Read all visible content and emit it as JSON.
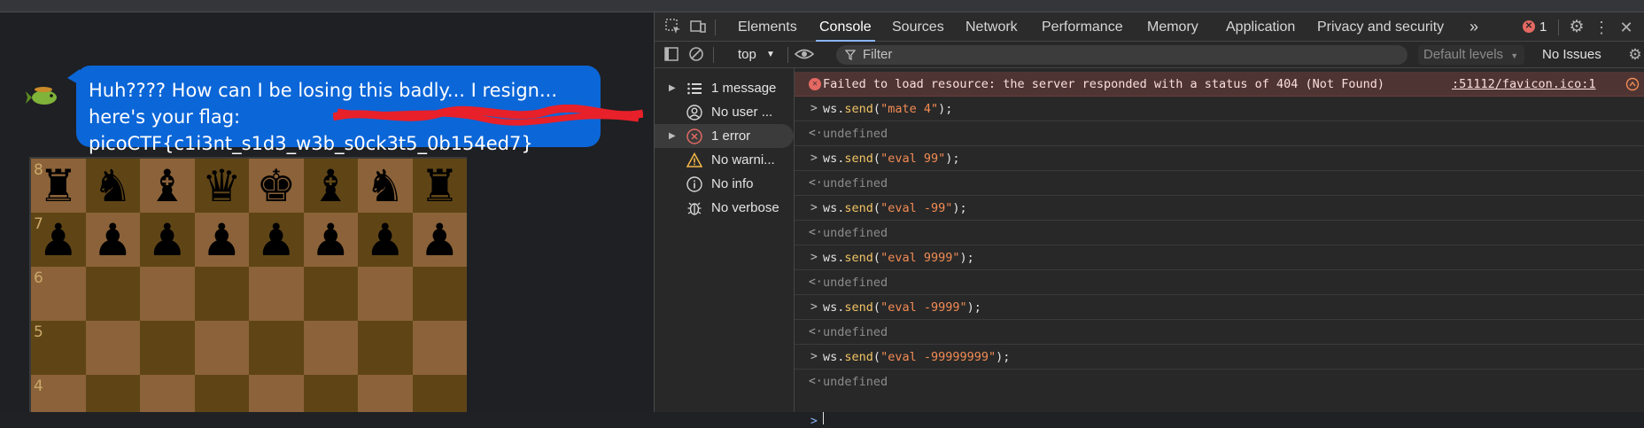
{
  "chat": {
    "message": "Huh???? How can I be losing this badly... I resign... here's your flag: picoCTF{c1i3nt_s1d3_w3b_s0ck3t5_0b154ed7}"
  },
  "board": {
    "ranks": [
      "8",
      "7",
      "6",
      "5",
      "4"
    ],
    "rank8": [
      "♜",
      "♞",
      "♝",
      "♛",
      "♚",
      "♝",
      "♞",
      "♜"
    ],
    "rank7": [
      "♟",
      "♟",
      "♟",
      "♟",
      "♟",
      "♟",
      "♟",
      "♟"
    ]
  },
  "devtools": {
    "tabs": [
      "Elements",
      "Console",
      "Sources",
      "Network",
      "Performance",
      "Memory",
      "Application",
      "Privacy and security"
    ],
    "active_tab": "Console",
    "error_count": "1",
    "toolbar": {
      "context": "top",
      "filter_placeholder": "Filter",
      "levels": "Default levels",
      "issues": "No Issues"
    },
    "sidebar": [
      {
        "label": "1 message",
        "icon": "list-icon"
      },
      {
        "label": "No user ...",
        "icon": "user-icon"
      },
      {
        "label": "1 error",
        "icon": "error-icon"
      },
      {
        "label": "No warni...",
        "icon": "warning-icon"
      },
      {
        "label": "No info",
        "icon": "info-icon"
      },
      {
        "label": "No verbose",
        "icon": "bug-icon"
      }
    ],
    "console": {
      "error": {
        "message": "Failed to load resource: the server responded with a status of 404 (Not Found)",
        "source": ":51112/favicon.ico:1"
      },
      "entries": [
        {
          "obj": "ws",
          "fn": "send",
          "arg": "\"mate 4\""
        },
        {
          "result": "undefined"
        },
        {
          "obj": "ws",
          "fn": "send",
          "arg": "\"eval 99\""
        },
        {
          "result": "undefined"
        },
        {
          "obj": "ws",
          "fn": "send",
          "arg": "\"eval -99\""
        },
        {
          "result": "undefined"
        },
        {
          "obj": "ws",
          "fn": "send",
          "arg": "\"eval 9999\""
        },
        {
          "result": "undefined"
        },
        {
          "obj": "ws",
          "fn": "send",
          "arg": "\"eval -9999\""
        },
        {
          "result": "undefined"
        },
        {
          "obj": "ws",
          "fn": "send",
          "arg": "\"eval -99999999\""
        },
        {
          "result": "undefined"
        }
      ]
    }
  }
}
